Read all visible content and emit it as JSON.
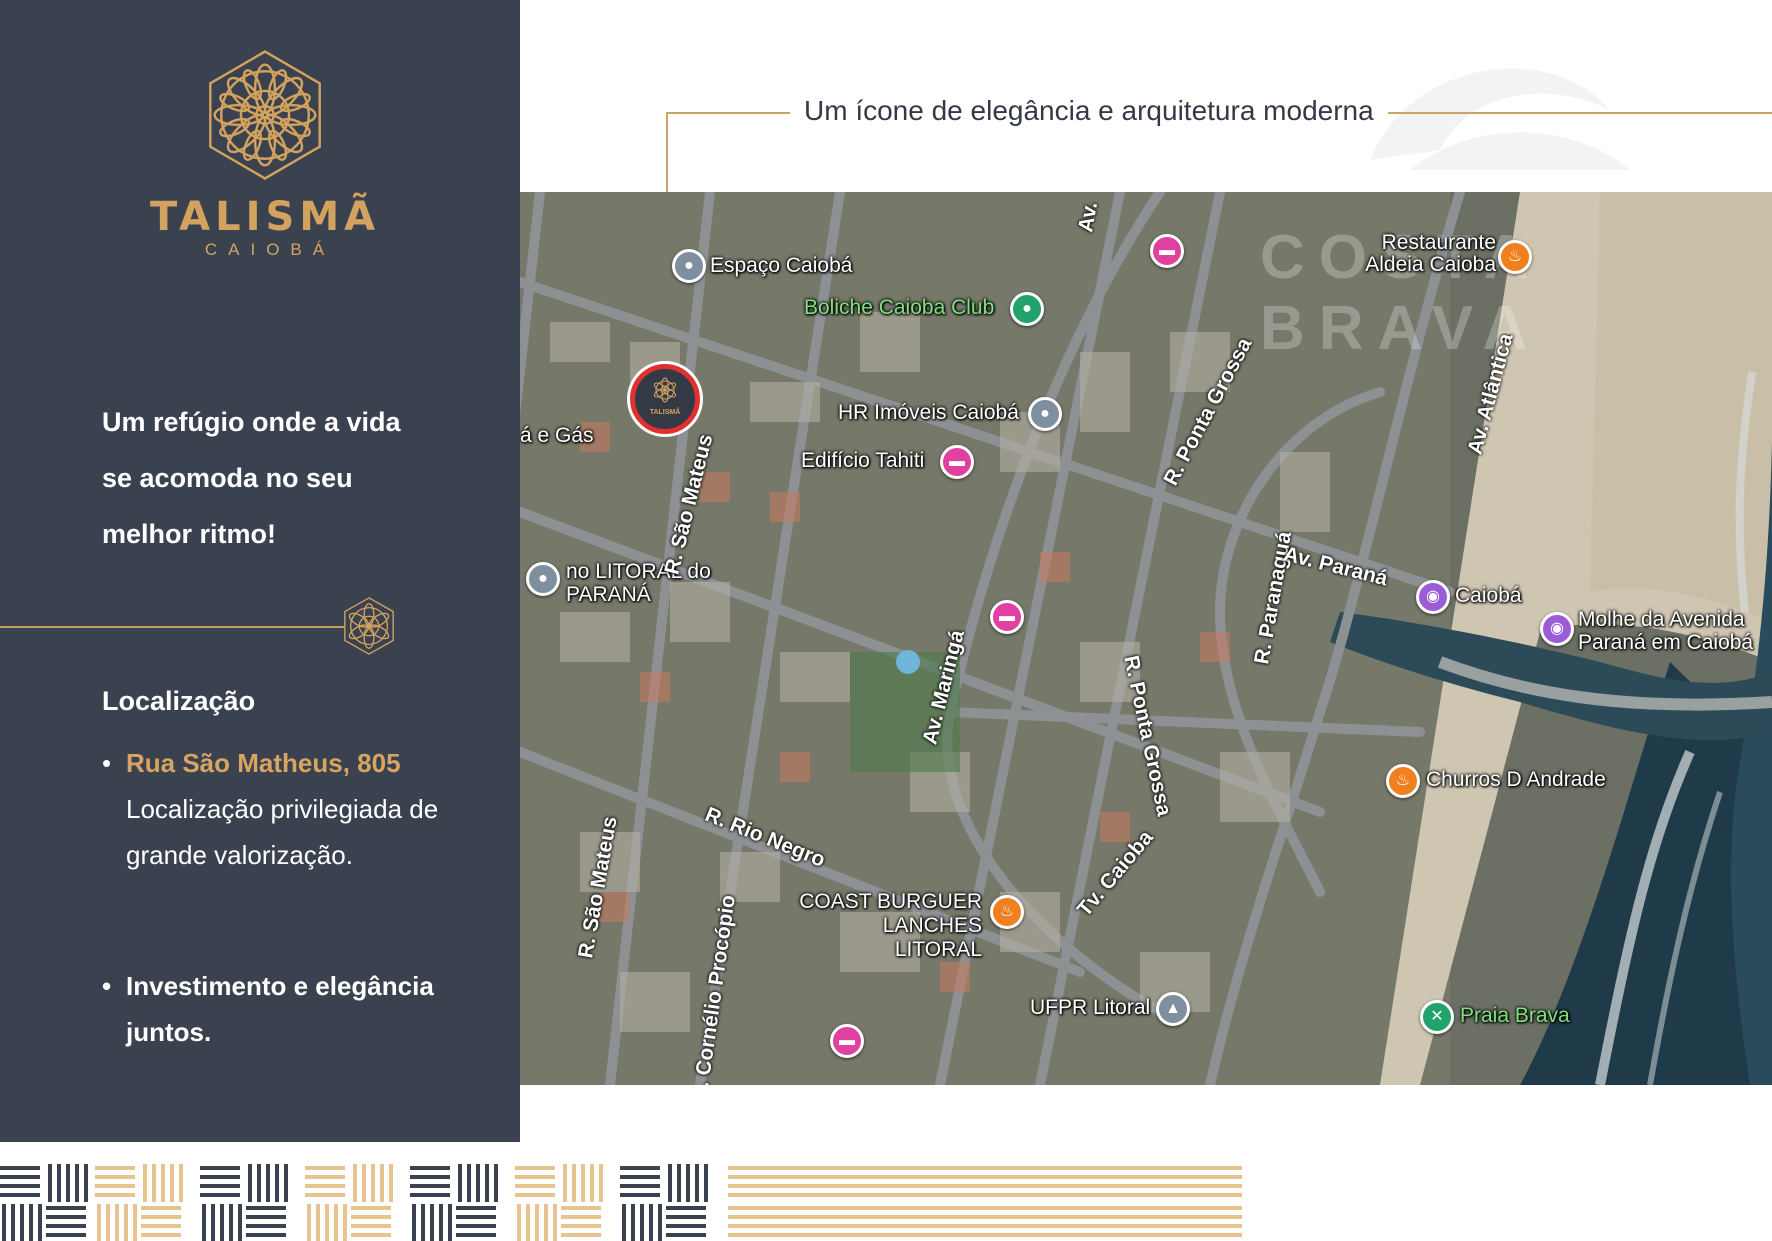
{
  "brand": {
    "name": "TALISMÃ",
    "sub": "CAIOBÁ"
  },
  "tagline": "Um refúgio onde a vida se acomoda no seu melhor ritmo!",
  "location": {
    "heading": "Localização",
    "bullet_symbol": "•",
    "address": "Rua São Matheus, 805",
    "address_desc": "Localização privilegiada de grande valorização.",
    "investment": "Investimento e elegância juntos."
  },
  "subtitle": "Um ícone de elegância e arquitetura moderna",
  "map": {
    "watermark": "COSTA BRAVA",
    "project_marker_text": "TALISMÃ",
    "places": [
      {
        "label": "Espaço Caiobá",
        "icon": "gray-pin-icon"
      },
      {
        "label": "Boliche Caioba Club",
        "icon": "green-pin-icon"
      },
      {
        "label": "Restaurante Aldeia Caioba",
        "icon": "restaurant-icon"
      },
      {
        "label": "HR Imóveis Caiobá",
        "icon": "gray-pin-icon"
      },
      {
        "label": "Edifício Tahiti",
        "icon": "hotel-icon"
      },
      {
        "label": "no LITORAL do PARANÁ",
        "icon": "gray-pin-icon"
      },
      {
        "label": "Caiobá",
        "icon": "camera-icon"
      },
      {
        "label": "Molhe da Avenida Paraná em Caiobá",
        "icon": "camera-icon"
      },
      {
        "label": "Churros D Andrade",
        "icon": "restaurant-icon"
      },
      {
        "label": "COAST BURGUER LANCHES LITORAL",
        "icon": "restaurant-icon"
      },
      {
        "label": "UFPR Litoral",
        "icon": "school-icon"
      },
      {
        "label": "Praia Brava",
        "icon": "park-icon"
      },
      {
        "label": "á e Gás",
        "icon": ""
      }
    ],
    "streets": [
      "Av.",
      "R. Ponta Grossa",
      "Av. Atlântica",
      "R. São Mateus",
      "R. Paranaguá",
      "Av. Paraná",
      "Av. Maringá",
      "R. Ponta Grossa",
      "R. Rio Negro",
      "Tv. Caioba",
      "R. São Mateus",
      "R. Cornélio Procópio"
    ]
  },
  "colors": {
    "sidebar": "#3a4250",
    "gold": "#d4a25f",
    "accent_line": "#c9a46a"
  }
}
